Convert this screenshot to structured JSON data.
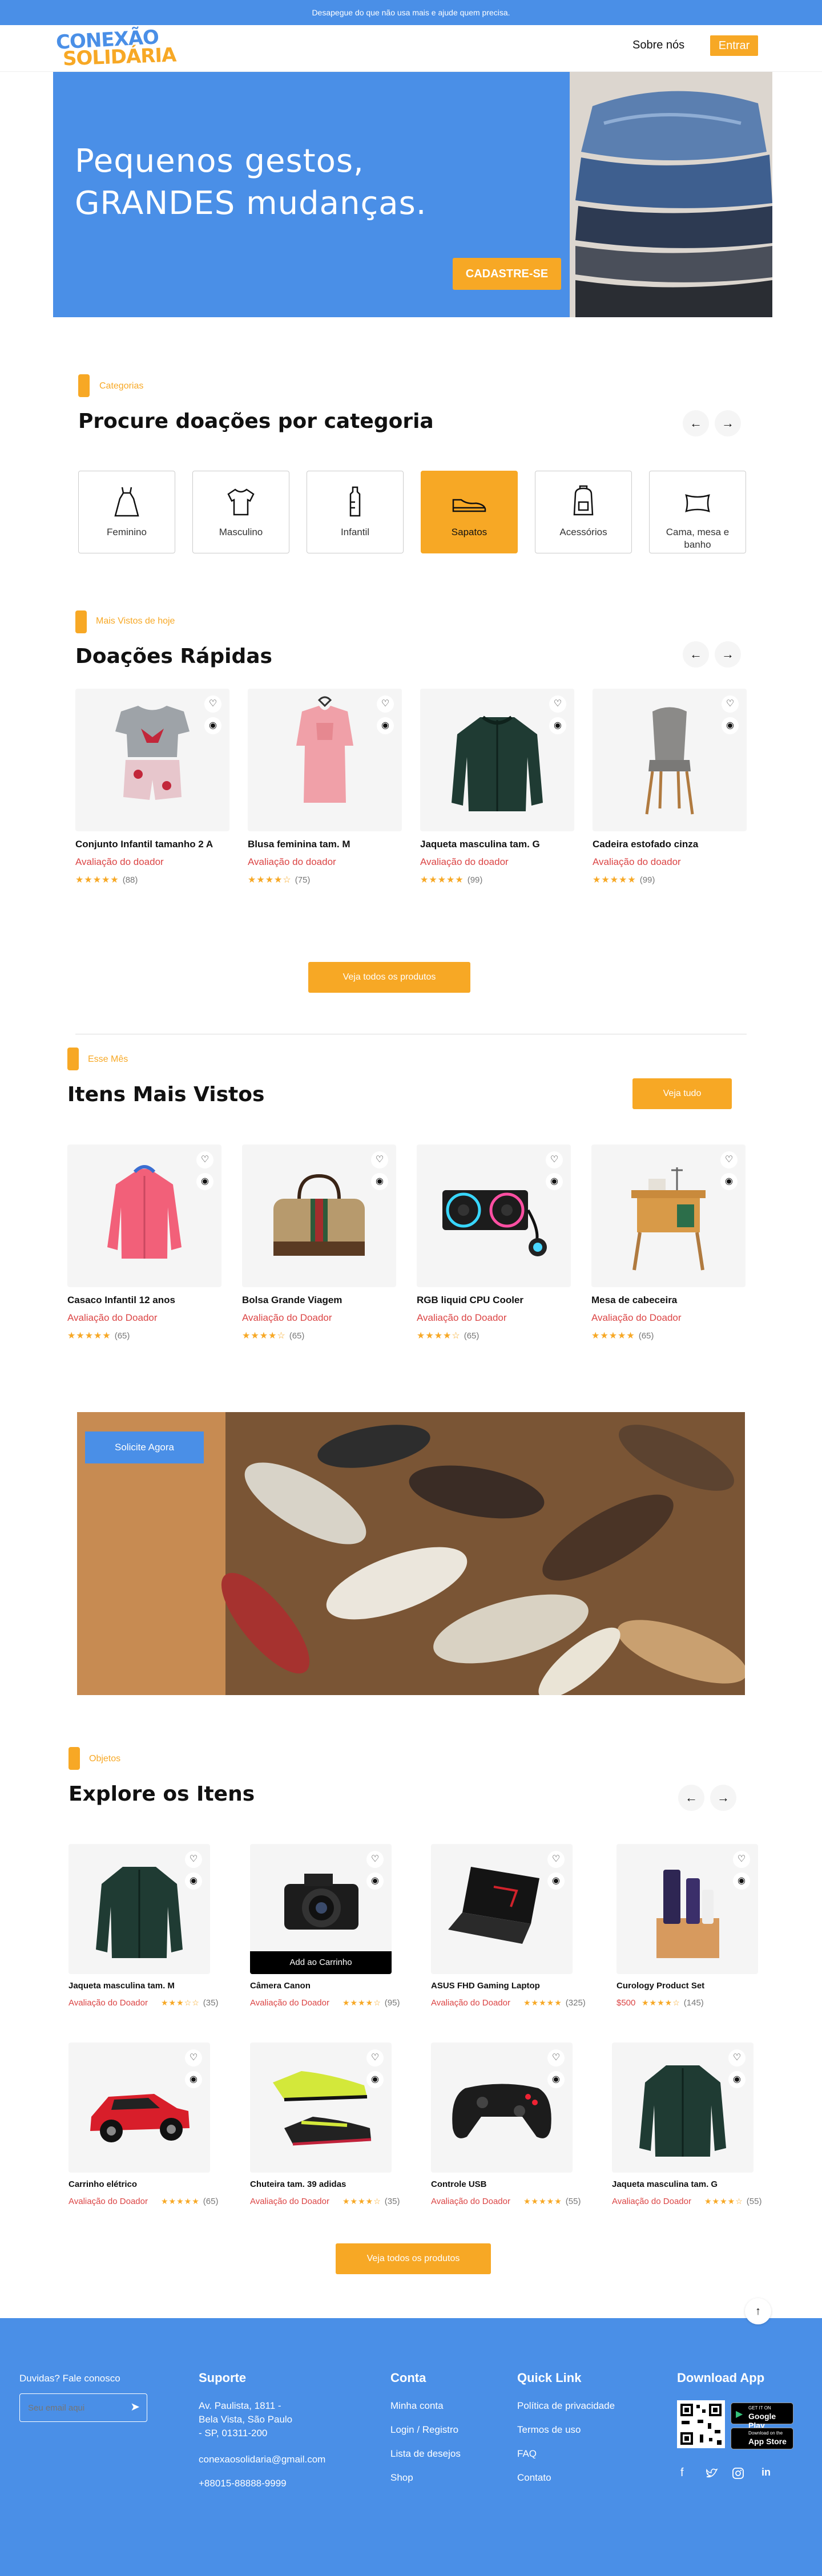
{
  "topbar": {
    "text": "Desapegue do que não usa mais e ajude quem precisa."
  },
  "header": {
    "logo_line1": "CONEXÃO",
    "logo_line2": "SOLIDÁRIA",
    "about": "Sobre nós",
    "enter": "Entrar"
  },
  "hero": {
    "line1": "Pequenos gestos,",
    "line2": "GRANDES mudanças.",
    "cta": "CADASTRE-SE"
  },
  "categories": {
    "tag": "Categorias",
    "title": "Procure doações por categoria",
    "items": [
      {
        "label": "Feminino",
        "icon": "dress-icon"
      },
      {
        "label": "Masculino",
        "icon": "shirt-icon"
      },
      {
        "label": "Infantil",
        "icon": "baby-bottle-icon"
      },
      {
        "label": "Sapatos",
        "icon": "shoe-icon",
        "selected": true
      },
      {
        "label": "Acessórios",
        "icon": "backpack-icon"
      },
      {
        "label": "Cama, mesa e banho",
        "icon": "pillow-icon"
      }
    ]
  },
  "quick": {
    "tag": "Mais Vistos de hoje",
    "title": "Doações Rápidas",
    "items": [
      {
        "name": "Conjunto Infantil tamanho 2 A",
        "eval": "Avaliação do doador",
        "stars": "★★★★★",
        "count": "(88)"
      },
      {
        "name": "Blusa feminina tam. M",
        "eval": "Avaliação do doador",
        "stars": "★★★★☆",
        "count": "(75)"
      },
      {
        "name": "Jaqueta masculina tam. G",
        "eval": "Avaliação do doador",
        "stars": "★★★★★",
        "count": "(99)"
      },
      {
        "name": "Cadeira estofado cinza",
        "eval": "Avaliação do doador",
        "stars": "★★★★★",
        "count": "(99)"
      }
    ],
    "see_all": "Veja todos os produtos"
  },
  "most_viewed": {
    "tag": "Esse Mês",
    "title": "Itens Mais Vistos",
    "see_all": "Veja tudo",
    "items": [
      {
        "name": "Casaco Infantil 12 anos",
        "eval": "Avaliação do Doador",
        "stars": "★★★★★",
        "count": "(65)"
      },
      {
        "name": "Bolsa Grande Viagem",
        "eval": "Avaliação do Doador",
        "stars": "★★★★☆",
        "count": "(65)"
      },
      {
        "name": "RGB liquid CPU Cooler",
        "eval": "Avaliação do Doador",
        "stars": "★★★★☆",
        "count": "(65)"
      },
      {
        "name": "Mesa de cabeceira",
        "eval": "Avaliação do Doador",
        "stars": "★★★★★",
        "count": "(65)"
      }
    ]
  },
  "banner": {
    "button": "Solicite Agora"
  },
  "explore": {
    "tag": "Objetos",
    "title": "Explore os Itens",
    "add_to_cart": "Add ao Carrinho",
    "items": [
      {
        "name": "Jaqueta masculina tam. M",
        "eval": "Avaliação do Doador",
        "stars": "★★★☆☆",
        "count": "(35)"
      },
      {
        "name": "Câmera Canon",
        "eval": "Avaliação do Doador",
        "stars": "★★★★☆",
        "count": "(95)"
      },
      {
        "name": "ASUS FHD Gaming Laptop",
        "eval": "Avaliação do Doador",
        "stars": "★★★★★",
        "count": "(325)"
      },
      {
        "name": "Curology Product Set",
        "eval": "$500",
        "stars": "★★★★☆",
        "count": "(145)"
      },
      {
        "name": "Carrinho elétrico",
        "eval": "Avaliação do Doador",
        "stars": "★★★★★",
        "count": "(65)"
      },
      {
        "name": "Chuteira tam. 39 adidas",
        "eval": "Avaliação do Doador",
        "stars": "★★★★☆",
        "count": "(35)"
      },
      {
        "name": "Controle USB",
        "eval": "Avaliação do Doador",
        "stars": "★★★★★",
        "count": "(55)"
      },
      {
        "name": "Jaqueta masculina tam. G",
        "eval": "Avaliação do Doador",
        "stars": "★★★★☆",
        "count": "(55)"
      }
    ],
    "see_all": "Veja todos os produtos"
  },
  "footer": {
    "contact_question": "Duvidas? Fale conosco",
    "email_placeholder": "Seu email aqui",
    "support_title": "Suporte",
    "address1": "Av. Paulista, 1811 -",
    "address2": "Bela Vista, São Paulo",
    "address3": "- SP, 01311-200",
    "email": "conexaosolidaria@gmail.com",
    "phone": "+88015-88888-9999",
    "account_title": "Conta",
    "account_links": [
      "Minha conta",
      "Login / Registro",
      "Lista de desejos",
      "Shop"
    ],
    "quick_title": "Quick Link",
    "quick_links": [
      "Política de privacidade",
      "Termos de uso",
      "FAQ",
      "Contato"
    ],
    "download_title": "Download App",
    "google_play_small": "GET IT ON",
    "google_play": "Google Play",
    "app_store_small": "Download on the",
    "app_store": "App Store"
  },
  "colors": {
    "brand_blue": "#4A8FE7",
    "accent_orange": "#F7A825",
    "rating_red": "#DB4444"
  }
}
